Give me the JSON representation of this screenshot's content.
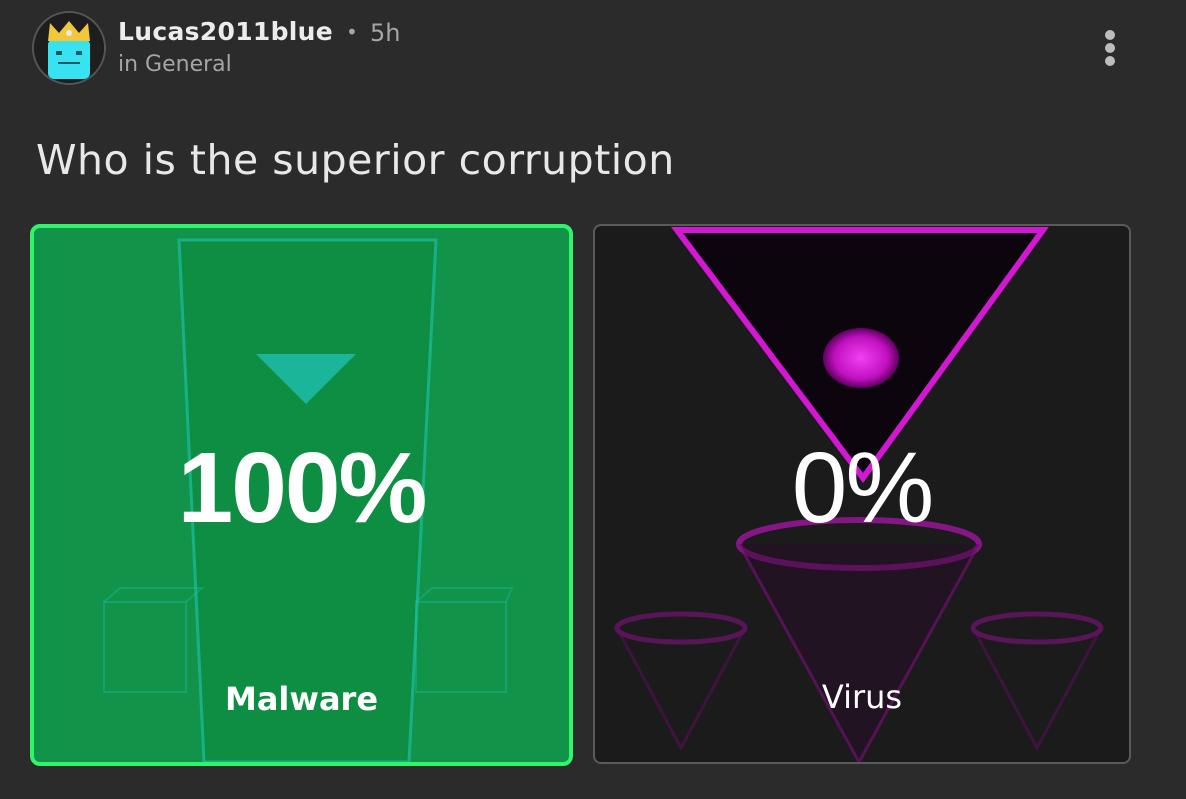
{
  "post": {
    "author": "Lucas2011blue",
    "separator": "•",
    "time_ago": "5h",
    "community": "in General",
    "title": "Who is the superior corruption",
    "menu_icon": "more-vertical-icon"
  },
  "poll": {
    "options": [
      {
        "label": "Malware",
        "percent_text": "100%",
        "percent": 100,
        "selected": true
      },
      {
        "label": "Virus",
        "percent_text": "0%",
        "percent": 0,
        "selected": false
      }
    ]
  },
  "colors": {
    "background": "#2b2b2b",
    "selected_fill": "#11934a",
    "selected_border": "#2ef56a",
    "unselected_border": "#5a5a5a",
    "virus_accent": "#d218d2",
    "malware_accent": "#1fc9b8"
  }
}
